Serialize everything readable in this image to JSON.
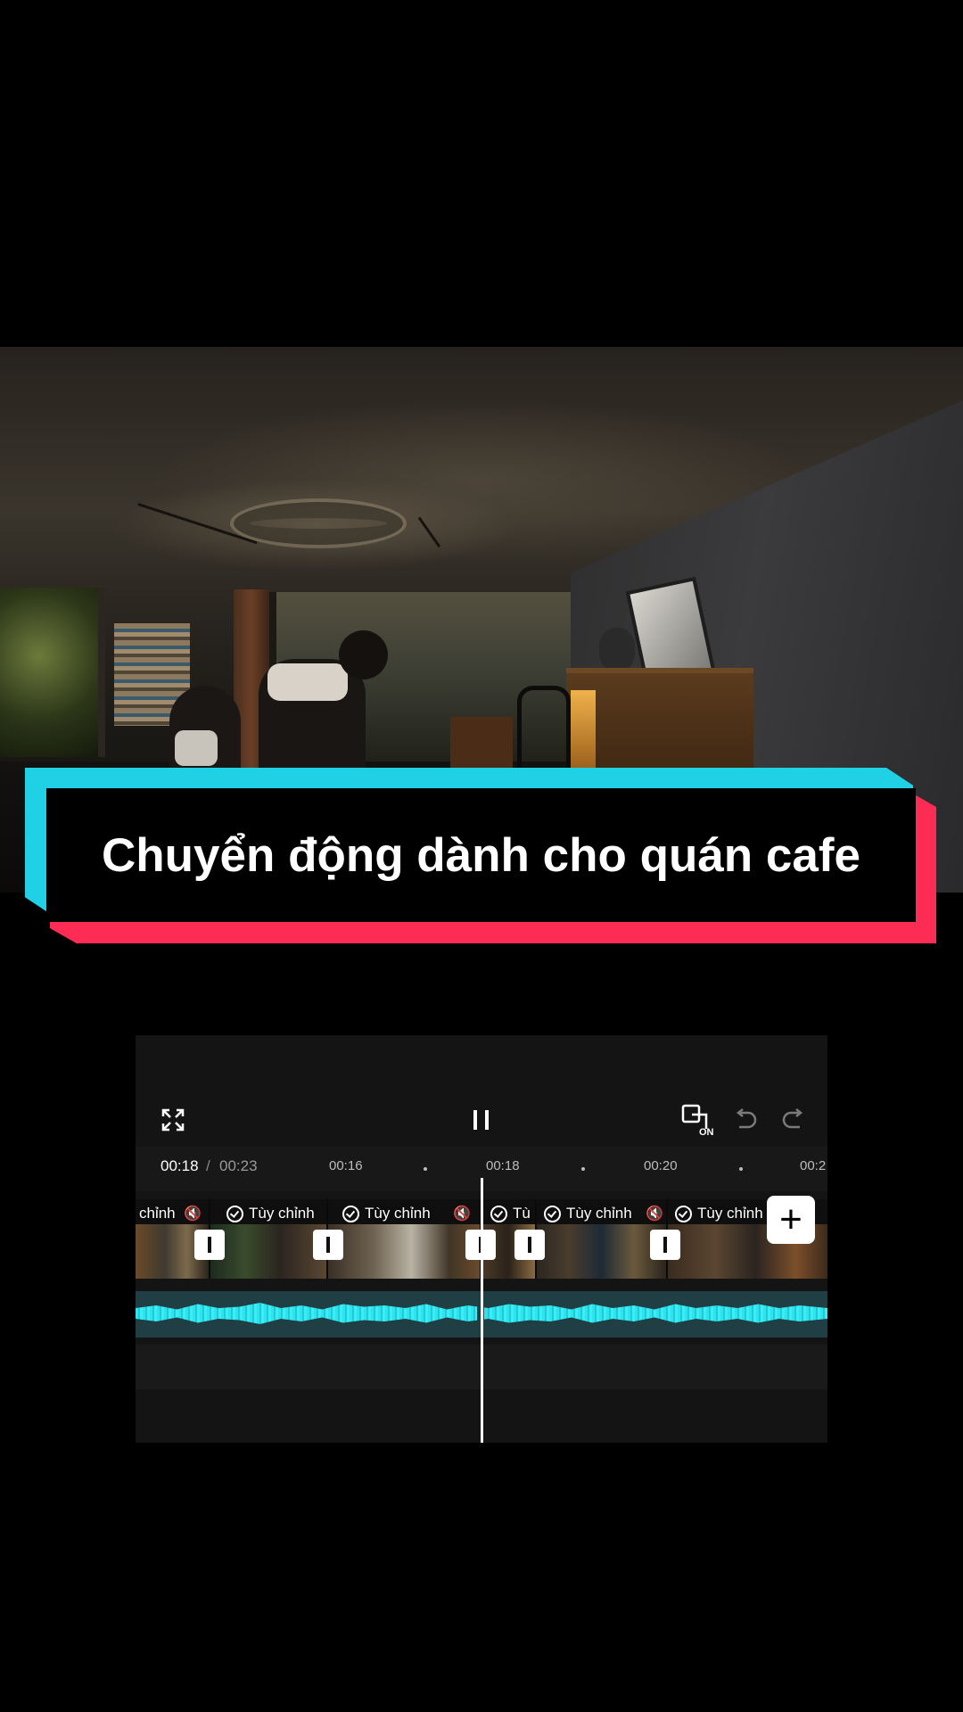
{
  "title_banner": {
    "text": "Chuyển động dành cho quán cafe"
  },
  "toolbar": {
    "fullscreen_icon": "fullscreen-icon",
    "pause_icon": "pause-icon",
    "keyframe_icon": "compare-on-icon",
    "keyframe_label": "ON",
    "undo_icon": "undo-icon",
    "redo_icon": "redo-icon"
  },
  "timecode": {
    "current": "00:18",
    "separator": "/",
    "total": "00:23"
  },
  "ruler_ticks": [
    "00:16",
    "00:18",
    "00:20",
    "00:2"
  ],
  "clips": {
    "labels": [
      "chỉnh",
      "Tùy chỉnh",
      "Tùy chỉnh",
      "Tù",
      "Tùy chỉnh",
      "Tùy chỉnh"
    ],
    "mute_icon": "mute-icon",
    "check_icon": "check-circle-icon"
  },
  "add_clip": {
    "label": "+"
  },
  "colors": {
    "accent_cyan": "#20d1e6",
    "accent_pink": "#fd2c55",
    "audio_wave": "#2ee3ee"
  }
}
